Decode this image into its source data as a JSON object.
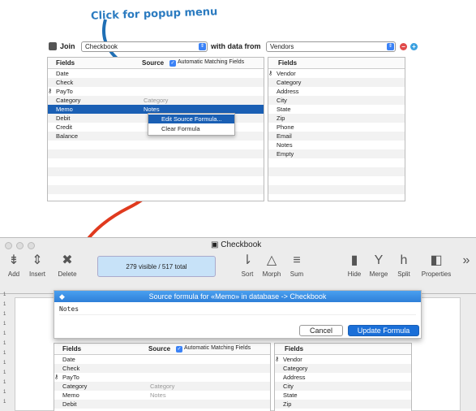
{
  "annotation": "Click for popup menu",
  "join": {
    "label": "Join",
    "database": "Checkbook",
    "with_label": "with data from",
    "source_db": "Vendors"
  },
  "left_panel": {
    "fields_header": "Fields",
    "source_header": "Source",
    "auto_label": "Automatic Matching Fields",
    "rows": [
      {
        "name": "Date",
        "source": ""
      },
      {
        "name": "Check",
        "source": ""
      },
      {
        "name": "PayTo",
        "source": "",
        "key": true
      },
      {
        "name": "Category",
        "source": "Category"
      },
      {
        "name": "Memo",
        "source": "Notes",
        "selected": true
      },
      {
        "name": "Debit",
        "source": ""
      },
      {
        "name": "Credit",
        "source": ""
      },
      {
        "name": "Balance",
        "source": ""
      }
    ]
  },
  "right_panel": {
    "fields_header": "Fields",
    "rows": [
      "Vendor",
      "Category",
      "Address",
      "City",
      "State",
      "Zip",
      "Phone",
      "Email",
      "Notes",
      "Empty"
    ]
  },
  "context_menu": [
    "Edit Source Formula...",
    "Clear Formula"
  ],
  "window": {
    "title": "Checkbook",
    "count": "279 visible / 517 total",
    "toolbar": [
      {
        "label": "Add",
        "icon": "add-icon"
      },
      {
        "label": "Insert",
        "icon": "insert-icon"
      },
      {
        "label": "Delete",
        "icon": "delete-icon"
      },
      {
        "label": "Sort",
        "icon": "sort-icon"
      },
      {
        "label": "Morph",
        "icon": "morph-icon"
      },
      {
        "label": "Sum",
        "icon": "sum-icon"
      },
      {
        "label": "Hide",
        "icon": "hide-icon"
      },
      {
        "label": "Merge",
        "icon": "merge-icon"
      },
      {
        "label": "Split",
        "icon": "split-icon"
      },
      {
        "label": "Properties",
        "icon": "properties-icon"
      }
    ]
  },
  "sheet": {
    "title": "Source formula for «Memo» in database -> Checkbook",
    "formula": "Notes",
    "cancel": "Cancel",
    "update": "Update Formula"
  },
  "lower_left_rows": [
    {
      "name": "Date",
      "source": ""
    },
    {
      "name": "Check",
      "source": ""
    },
    {
      "name": "PayTo",
      "source": "",
      "key": true
    },
    {
      "name": "Category",
      "source": "Category"
    },
    {
      "name": "Memo",
      "source": "Notes"
    },
    {
      "name": "Debit",
      "source": ""
    }
  ],
  "lower_right_rows": [
    "Vendor",
    "Category",
    "Address",
    "City",
    "State",
    "Zip"
  ],
  "gutter_marks": [
    "1",
    "1",
    "1",
    "1",
    "1",
    "1",
    "1",
    "1",
    "1",
    "1",
    "1",
    "1"
  ],
  "colors": {
    "accent": "#1a5fb4",
    "arrow_blue": "#1f6fb5",
    "arrow_red": "#e03a1e"
  }
}
